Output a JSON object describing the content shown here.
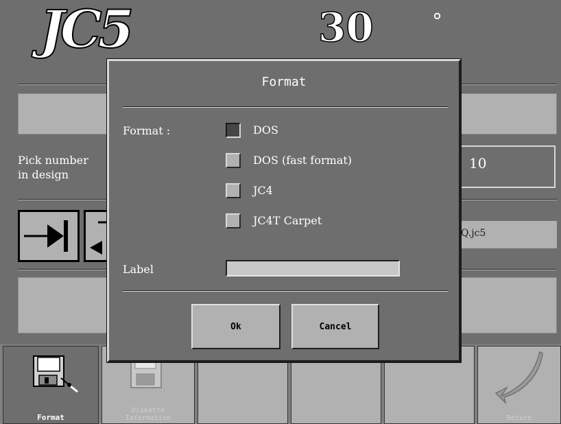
{
  "app": {
    "logo": "JC5",
    "temperature": "30",
    "degree_symbol": "°",
    "pick_label": "Pick number\nin design",
    "pick_value": "10",
    "file_value": "Q.jc5"
  },
  "dialog": {
    "title": "Format",
    "format_label": "Format :",
    "options": [
      {
        "label": "DOS",
        "checked": true
      },
      {
        "label": "DOS (fast format)",
        "checked": false
      },
      {
        "label": "JC4",
        "checked": false
      },
      {
        "label": "JC4T Carpet",
        "checked": false
      }
    ],
    "label_label": "Label",
    "label_value": "",
    "ok_label": "Ok",
    "cancel_label": "Cancel"
  },
  "toolbar": {
    "format_label": "Format",
    "diskette_label": "Diskette\nInformation",
    "return_label": "Return"
  }
}
